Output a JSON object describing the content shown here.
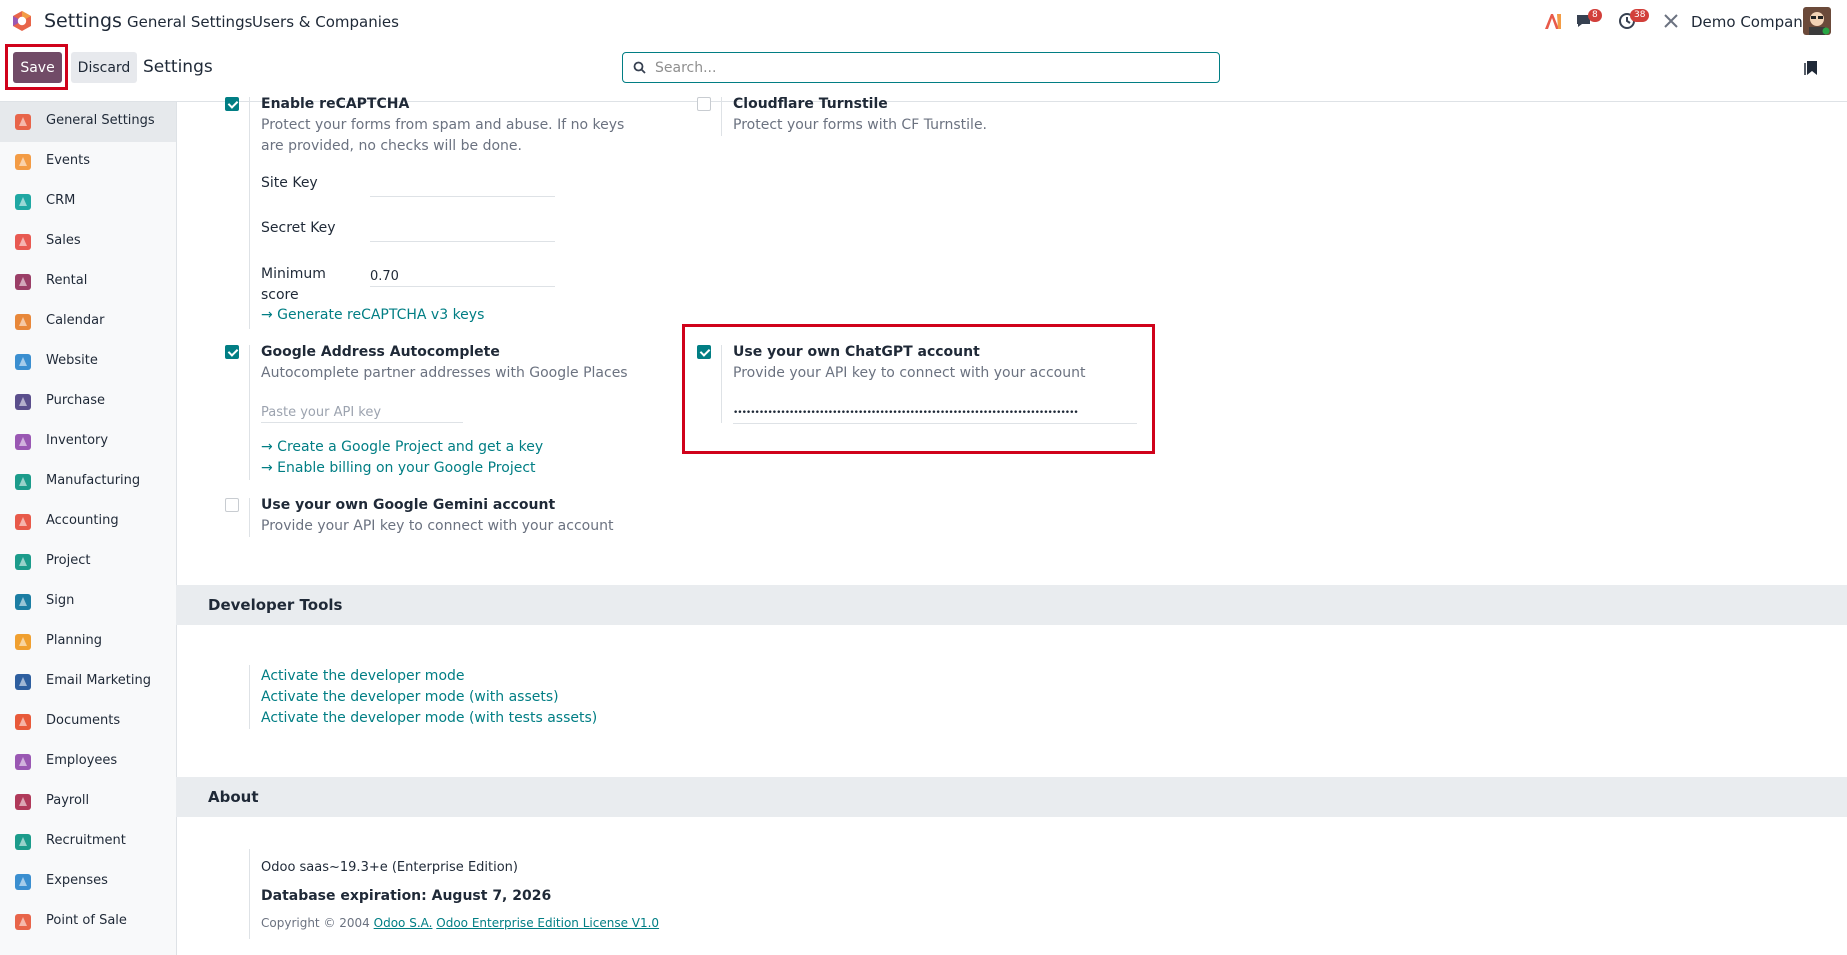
{
  "topbar": {
    "app_title": "Settings",
    "menu": [
      "General Settings",
      "Users & Companies"
    ],
    "chat_count": "8",
    "activity_count": "38",
    "company": "Demo Company"
  },
  "control": {
    "save_label": "Save",
    "discard_label": "Discard",
    "title": "Settings",
    "search_placeholder": "Search..."
  },
  "sidebar": {
    "items": [
      {
        "label": "General Settings",
        "icon": "odoo-settings-icon",
        "color": "#e8654a"
      },
      {
        "label": "Events",
        "icon": "events-icon",
        "color": "#f39c45"
      },
      {
        "label": "CRM",
        "icon": "crm-icon",
        "color": "#20a8a3"
      },
      {
        "label": "Sales",
        "icon": "sales-icon",
        "color": "#e85a52"
      },
      {
        "label": "Rental",
        "icon": "rental-icon",
        "color": "#9b3f67"
      },
      {
        "label": "Calendar",
        "icon": "calendar-icon",
        "color": "#e8883a"
      },
      {
        "label": "Website",
        "icon": "website-icon",
        "color": "#3b8fd0"
      },
      {
        "label": "Purchase",
        "icon": "purchase-icon",
        "color": "#5b4f8c"
      },
      {
        "label": "Inventory",
        "icon": "inventory-icon",
        "color": "#9a58b3"
      },
      {
        "label": "Manufacturing",
        "icon": "manufacturing-icon",
        "color": "#1c9c8b"
      },
      {
        "label": "Accounting",
        "icon": "accounting-icon",
        "color": "#e85a4a"
      },
      {
        "label": "Project",
        "icon": "project-icon",
        "color": "#1c9c8b"
      },
      {
        "label": "Sign",
        "icon": "sign-icon",
        "color": "#1c7ea3"
      },
      {
        "label": "Planning",
        "icon": "planning-icon",
        "color": "#f0a030"
      },
      {
        "label": "Email Marketing",
        "icon": "email-marketing-icon",
        "color": "#2e5f9f"
      },
      {
        "label": "Documents",
        "icon": "documents-icon",
        "color": "#e85a3a"
      },
      {
        "label": "Employees",
        "icon": "employees-icon",
        "color": "#9a58b3"
      },
      {
        "label": "Payroll",
        "icon": "payroll-icon",
        "color": "#b03a5a"
      },
      {
        "label": "Recruitment",
        "icon": "recruitment-icon",
        "color": "#1c9c8b"
      },
      {
        "label": "Expenses",
        "icon": "expenses-icon",
        "color": "#3b8fd0"
      },
      {
        "label": "Point of Sale",
        "icon": "point-of-sale-icon",
        "color": "#e8654a"
      }
    ]
  },
  "integrations": {
    "recaptcha": {
      "title": "Enable reCAPTCHA",
      "desc": "Protect your forms from spam and abuse. If no keys are provided, no checks will be done.",
      "site_key_label": "Site Key",
      "site_key_value": "",
      "secret_key_label": "Secret Key",
      "secret_key_value": "",
      "min_score_label": "Minimum score",
      "min_score_value": "0.70",
      "link": "→ Generate reCAPTCHA v3 keys",
      "checked": true
    },
    "turnstile": {
      "title": "Cloudflare Turnstile",
      "desc": "Protect your forms with CF Turnstile.",
      "checked": false
    },
    "google_address": {
      "title": "Google Address Autocomplete",
      "desc": "Autocomplete partner addresses with Google Places",
      "api_placeholder": "Paste your API key",
      "link1": "→ Create a Google Project and get a key",
      "link2": "→ Enable billing on your Google Project",
      "checked": true
    },
    "chatgpt": {
      "title": "Use your own ChatGPT account",
      "desc": "Provide your API key to connect with your account",
      "api_key_masked": "••••••••••••••••••••••••••••••••••••••••••••••••••••••••••••••••••••••••••••••••",
      "checked": true
    },
    "gemini": {
      "title": "Use your own Google Gemini account",
      "desc": "Provide your API key to connect with your account",
      "checked": false
    }
  },
  "developer": {
    "heading": "Developer Tools",
    "links": [
      "Activate the developer mode",
      "Activate the developer mode (with assets)",
      "Activate the developer mode (with tests assets)"
    ]
  },
  "about": {
    "heading": "About",
    "version": "Odoo saas~19.3+e (Enterprise Edition)",
    "expiration": "Database expiration: August 7, 2026",
    "copyright_prefix": "Copyright © 2004",
    "company_link": "Odoo S.A.",
    "license_link": "Odoo Enterprise Edition License V1.0"
  },
  "colors": {
    "brand": "#714b67",
    "accent": "#017e84",
    "highlight": "#d0021b",
    "badge": "#d23f3a"
  }
}
